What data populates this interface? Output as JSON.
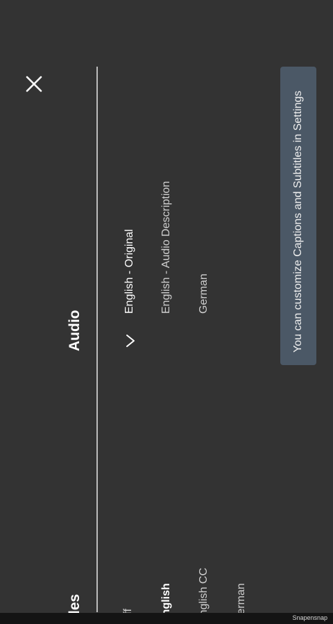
{
  "panel": {
    "audio_heading": "Audio",
    "subtitles_heading": "les",
    "audio_options": [
      {
        "label": "English - Original",
        "selected": true
      },
      {
        "label": "English - Audio Description",
        "selected": false
      },
      {
        "label": "German",
        "selected": false
      }
    ],
    "subtitle_options": [
      {
        "label": "Off",
        "selected": false
      },
      {
        "label": "English",
        "selected": true
      },
      {
        "label": "English CC",
        "selected": false
      },
      {
        "label": "German",
        "selected": false
      }
    ]
  },
  "toast": {
    "message": "You can customize Captions and Subtitles in Settings"
  },
  "footer": {
    "watermark": "Snapensnap"
  },
  "icons": {
    "close": "close-icon",
    "check": "checkmark-icon"
  },
  "colors": {
    "background": "#333333",
    "toast": "#4b5866",
    "divider": "#bdbdbd"
  }
}
